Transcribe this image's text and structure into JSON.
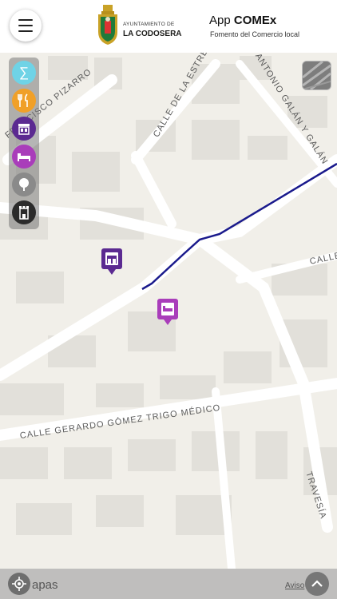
{
  "header": {
    "org_line1": "AYUNTAMIENTO DE",
    "org_line2": "LA CODOSERA",
    "app_title_prefix": "App",
    "app_title_bold": "COMEx",
    "app_subtitle": "Fomento del Comercio local"
  },
  "categories": [
    {
      "name": "all",
      "icon": "sigma-icon",
      "color": "#6fd3e6",
      "glyph": "∑"
    },
    {
      "name": "restaurants",
      "icon": "fork-knife-icon",
      "color": "#f0a028",
      "glyph": "🍴"
    },
    {
      "name": "shops",
      "icon": "shop-icon",
      "color": "#5b2a91"
    },
    {
      "name": "lodging",
      "icon": "bed-icon",
      "color": "#a93dba"
    },
    {
      "name": "nature",
      "icon": "tree-icon",
      "color": "#8a8a8a"
    },
    {
      "name": "monuments",
      "icon": "tower-icon",
      "color": "#2b2b2b"
    }
  ],
  "streets": [
    {
      "id": "pizarro",
      "label": "FRANCISCO PIZARRO"
    },
    {
      "id": "estrella",
      "label": "CALLE DE LA ESTRELLA"
    },
    {
      "id": "galan",
      "label": "ANTONIO GALÁN Y GALÁN"
    },
    {
      "id": "calle-right",
      "label": "CALLE"
    },
    {
      "id": "gerardo",
      "label": "CALLE GERARDO GÓMEZ TRIGO MÉDICO"
    },
    {
      "id": "travesia",
      "label": "TRAVESÍA"
    }
  ],
  "pins": [
    {
      "type": "shop",
      "color": "#5b2a91"
    },
    {
      "type": "lodging",
      "color": "#a93dba"
    }
  ],
  "route_color": "#1a1a8c",
  "footer": {
    "maps_label": "apas",
    "notice_label": "Aviso"
  }
}
